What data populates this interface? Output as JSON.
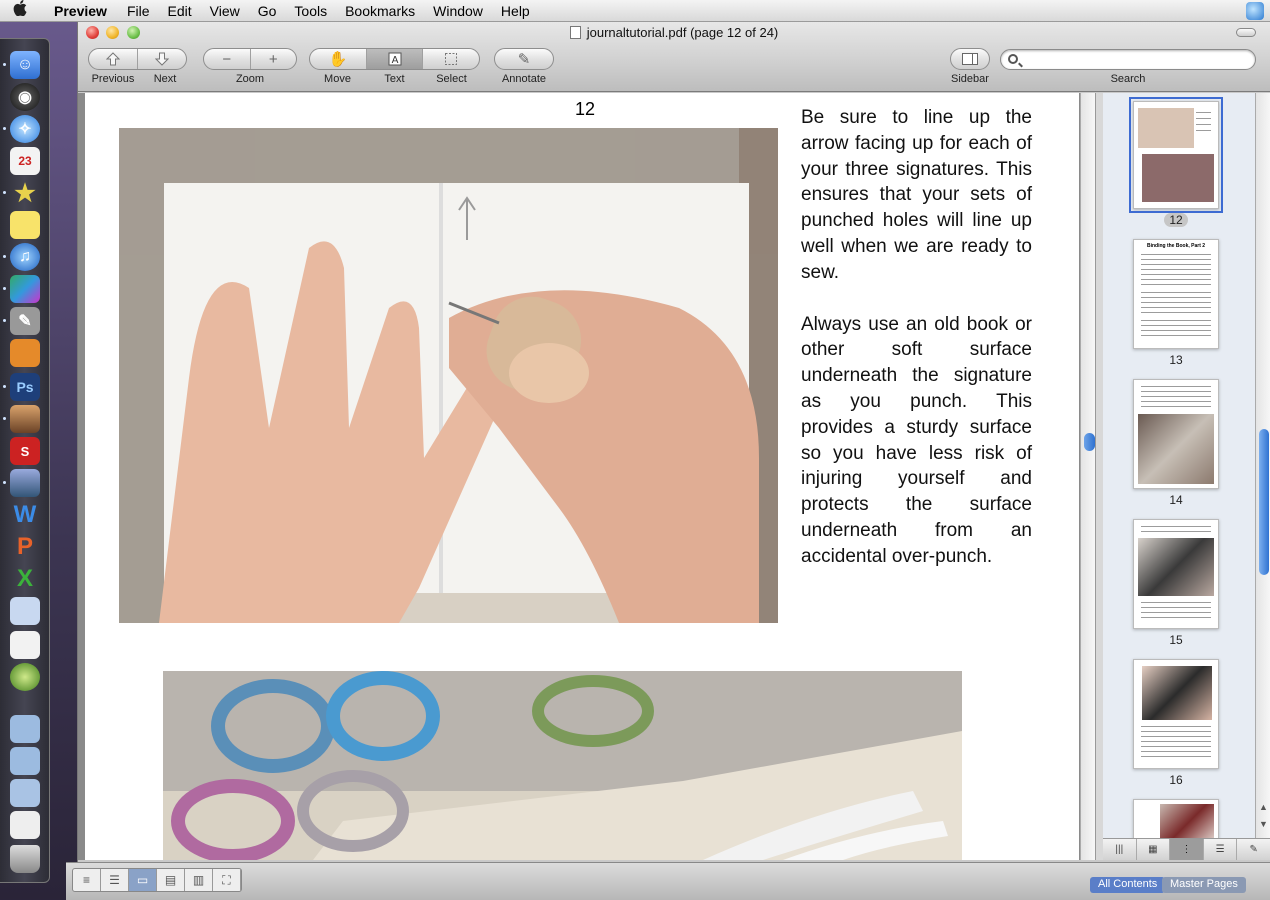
{
  "menubar": {
    "app_name": "Preview",
    "items": [
      "File",
      "Edit",
      "View",
      "Go",
      "Tools",
      "Bookmarks",
      "Window",
      "Help"
    ]
  },
  "window": {
    "title": "journaltutorial.pdf (page 12 of 24)"
  },
  "toolbar": {
    "previous_label": "Previous",
    "next_label": "Next",
    "zoom_label": "Zoom",
    "move_label": "Move",
    "text_label": "Text",
    "select_label": "Select",
    "annotate_label": "Annotate",
    "sidebar_label": "Sidebar",
    "search_label": "Search",
    "search_value": ""
  },
  "page": {
    "number": "12",
    "paragraph1": "Be sure to line up the arrow facing up for each of your three signatures. This ensures that your sets of punched holes will line up well when we are ready to sew.",
    "paragraph2": "Always use an old book or other soft surface underneath the signature as you punch. This provides a sturdy surface so you have less risk of injuring yourself and protects the surface underneath from an accidental over-punch."
  },
  "sidebar": {
    "thumbnails": [
      {
        "label": "12",
        "selected": true
      },
      {
        "label": "13",
        "heading": "Binding the Book, Part 2"
      },
      {
        "label": "14"
      },
      {
        "label": "15"
      },
      {
        "label": "16"
      }
    ]
  },
  "bottom_tabs": {
    "all_contents": "All Contents",
    "master_pages": "Master Pages"
  },
  "colors": {
    "selection_blue": "#3d6bd2",
    "scroll_blue": "#2f72d1"
  }
}
